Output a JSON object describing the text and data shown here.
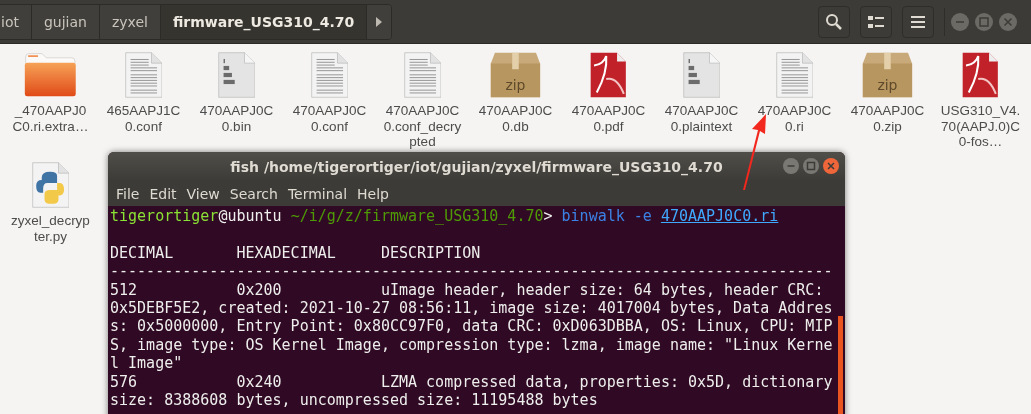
{
  "breadcrumbs": [
    {
      "label": "iot",
      "selected": false
    },
    {
      "label": "gujian",
      "selected": false
    },
    {
      "label": "zyxel",
      "selected": false
    },
    {
      "label": "firmware_USG310_4.70",
      "selected": true
    }
  ],
  "files": [
    {
      "name": "_470AAPJ0C0.ri.extra…",
      "kind": "folder"
    },
    {
      "name": "465AAPJ1C0.conf",
      "kind": "text"
    },
    {
      "name": "470AAPJ0C0.bin",
      "kind": "binary"
    },
    {
      "name": "470AAPJ0C0.conf",
      "kind": "text"
    },
    {
      "name": "470AAPJ0C0.conf_decrypted",
      "kind": "text"
    },
    {
      "name": "470AAPJ0C0.db",
      "kind": "zip",
      "badge": "zip"
    },
    {
      "name": "470AAPJ0C0.pdf",
      "kind": "pdf"
    },
    {
      "name": "470AAPJ0C0.plaintext",
      "kind": "binary"
    },
    {
      "name": "470AAPJ0C0.ri",
      "kind": "text"
    },
    {
      "name": "470AAPJ0C0.zip",
      "kind": "zip",
      "badge": "zip"
    },
    {
      "name": "USG310_V4.70(AAPJ.0)C0-fos…",
      "kind": "pdf"
    },
    {
      "name": "zyxel_decrypter.py",
      "kind": "python"
    }
  ],
  "terminal": {
    "title": "fish /home/tigerortiger/iot/gujian/zyxel/firmware_USG310_4.70",
    "menu": [
      "File",
      "Edit",
      "View",
      "Search",
      "Terminal",
      "Help"
    ],
    "prompt": {
      "user": "tigerortiger",
      "host": "@ubuntu",
      "path": "~/i/g/z/firmware_USG310_4.70",
      "symbol": ">",
      "command": "binwalk -e",
      "argument": "470AAPJ0C0.ri"
    },
    "lines": [
      "DECIMAL       HEXADECIMAL     DESCRIPTION",
      "--------------------------------------------------------------------------------",
      "512           0x200           uImage header, header size: 64 bytes, header CRC: 0x5DEBF5E2, created: 2021-10-27 08:56:11, image size: 4017004 bytes, Data Address: 0x5000000, Entry Point: 0x80CC97F0, data CRC: 0xD063DBBA, OS: Linux, CPU: MIPS, image type: OS Kernel Image, compression type: lzma, image name: \"Linux Kernel Image\"",
      "576           0x240           LZMA compressed data, properties: 0x5D, dictionary size: 8388608 bytes, uncompressed size: 11195488 bytes"
    ]
  }
}
